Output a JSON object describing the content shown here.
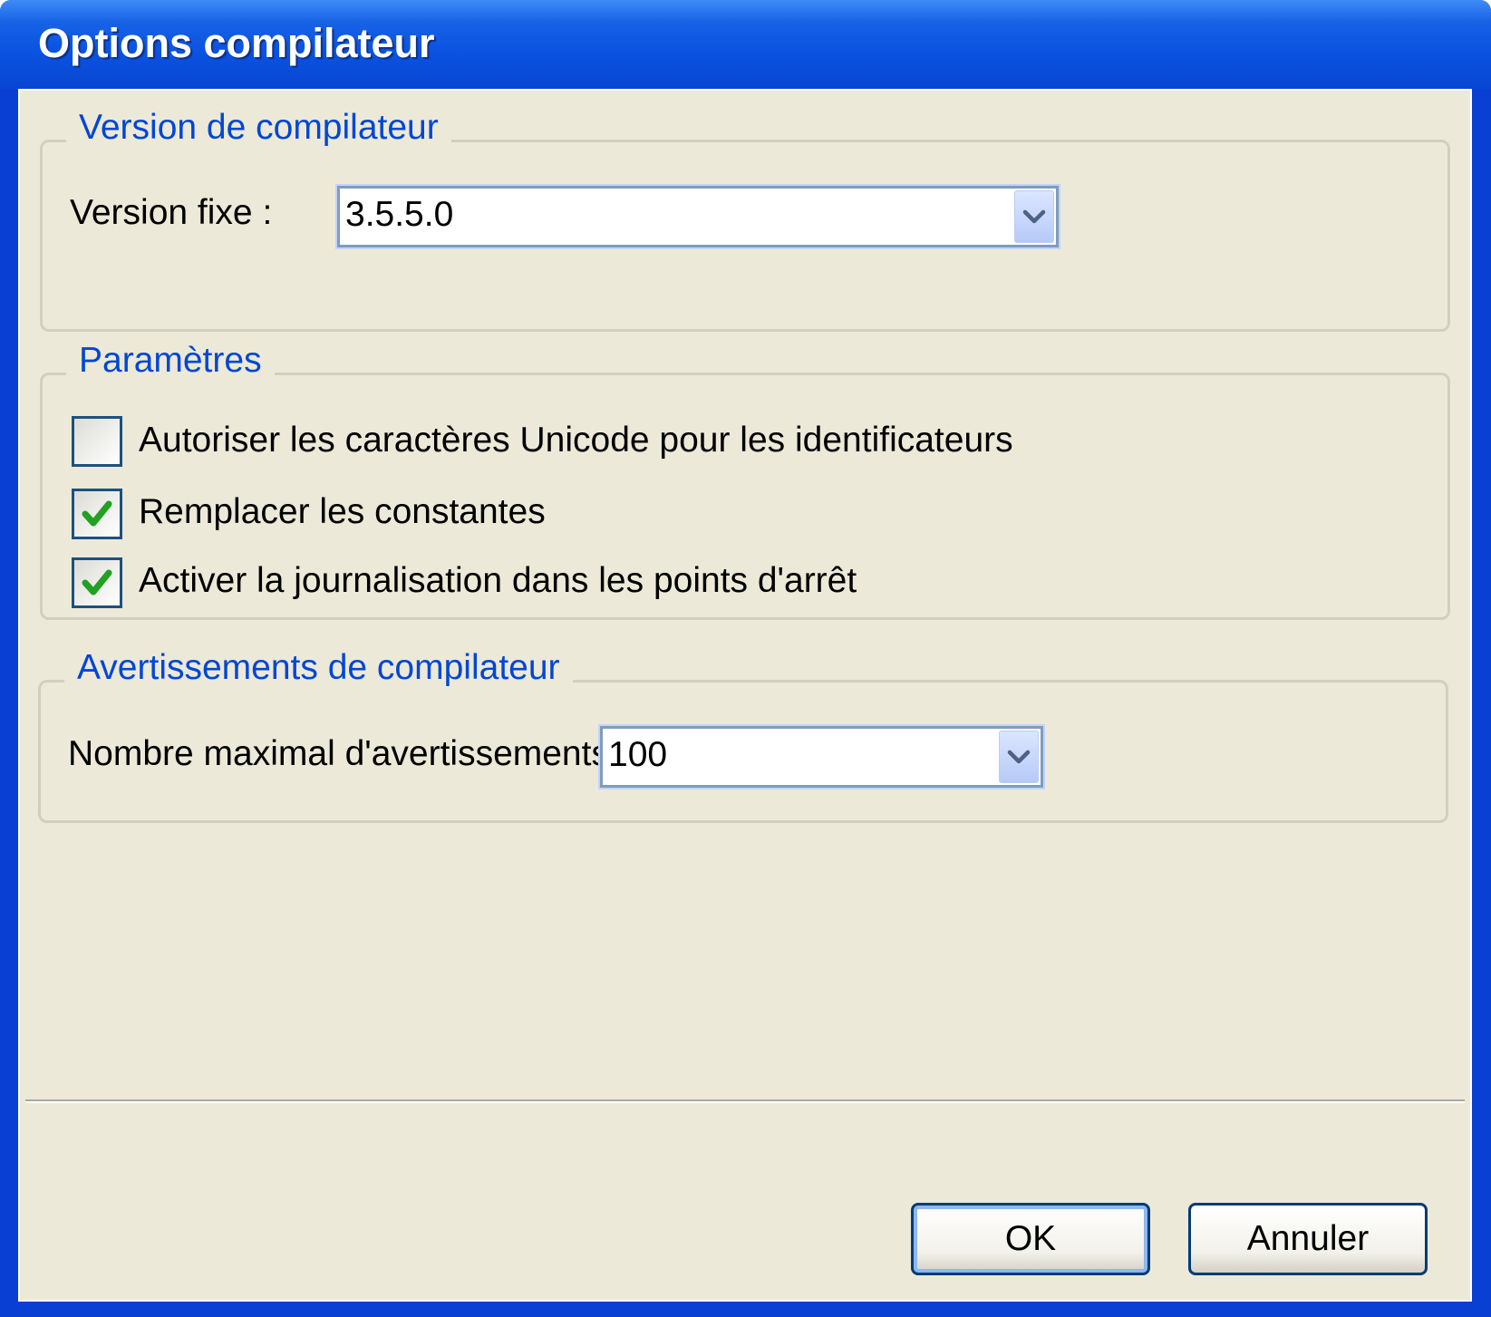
{
  "window": {
    "title": "Options compilateur"
  },
  "version_group": {
    "legend": "Version de compilateur",
    "fixed_version_label": "Version fixe :",
    "fixed_version_value": "3.5.5.0"
  },
  "params_group": {
    "legend": "Paramètres",
    "options": [
      {
        "label": "Autoriser les caractères Unicode pour les identificateurs",
        "checked": false
      },
      {
        "label": "Remplacer les constantes",
        "checked": true
      },
      {
        "label": "Activer la journalisation dans les points d'arrêt",
        "checked": true
      }
    ]
  },
  "warnings_group": {
    "legend": "Avertissements de compilateur",
    "max_warnings_label": "Nombre maximal d'avertissements :",
    "max_warnings_value": "100"
  },
  "buttons": {
    "ok": "OK",
    "cancel": "Annuler"
  },
  "colors": {
    "title_bar": "#0a52e0",
    "legend_text": "#0046d5",
    "client_bg": "#ece9d8",
    "check_mark": "#21a121"
  },
  "icons": {
    "dropdown": "chevron-down-icon",
    "check": "checkmark-icon"
  }
}
